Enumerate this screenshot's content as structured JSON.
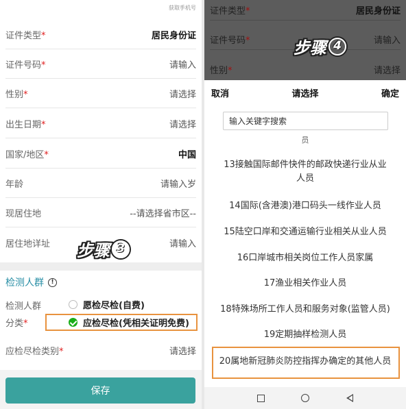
{
  "left": {
    "get_phone": "获取手机号",
    "fields": [
      {
        "label": "证件类型",
        "required": true,
        "value": "居民身份证",
        "bold": true
      },
      {
        "label": "证件号码",
        "required": true,
        "value": "请输入",
        "bold": false
      },
      {
        "label": "性别",
        "required": true,
        "value": "请选择",
        "bold": false
      },
      {
        "label": "出生日期",
        "required": true,
        "value": "请选择",
        "bold": false
      },
      {
        "label": "国家/地区",
        "required": true,
        "value": "中国",
        "bold": true
      },
      {
        "label": "年龄",
        "required": false,
        "value": "请输入岁",
        "bold": false
      },
      {
        "label": "现居住地",
        "required": false,
        "value": "--请选择省市区--",
        "bold": false
      },
      {
        "label": "居住地详址",
        "required": false,
        "value": "请输入",
        "bold": false
      }
    ],
    "step_label": "步骤",
    "step_number": "3",
    "section_title": "检测人群",
    "group_label": "检测人群",
    "class_label": "分类",
    "option_self_pay": "愿检尽检(自费)",
    "option_free": "应检尽检(凭相关证明免费)",
    "category_label": "应检尽检类别",
    "category_value": "请选择",
    "save_label": "保存"
  },
  "right": {
    "dim_rows": [
      {
        "label": "证件类型",
        "value": "居民身份证"
      },
      {
        "label": "证件号码",
        "value": "请输入"
      },
      {
        "label": "性别",
        "value": "请选择"
      }
    ],
    "step_label": "步骤",
    "step_number": "4",
    "cancel": "取消",
    "title": "请选择",
    "confirm": "确定",
    "search_placeholder": "输入关键字搜索",
    "options": [
      "员",
      "13接触国际邮件快件的邮政快递行业从业人员",
      "14国际(含港澳)港口码头一线作业人员",
      "15陆空口岸和交通运输行业相关从业人员",
      "16口岸城市相关岗位工作人员家属",
      "17渔业相关作业人员",
      "18特殊场所工作人员和服务对象(监管人员)",
      "19定期抽样检测人员",
      "20属地新冠肺炎防控指挥办确定的其他人员"
    ]
  },
  "colors": {
    "accent_teal": "#3aa29e",
    "highlight_orange": "#e8923e",
    "required_red": "#e02020",
    "section_blue": "#2a8fa6",
    "check_green": "#1aad19"
  }
}
